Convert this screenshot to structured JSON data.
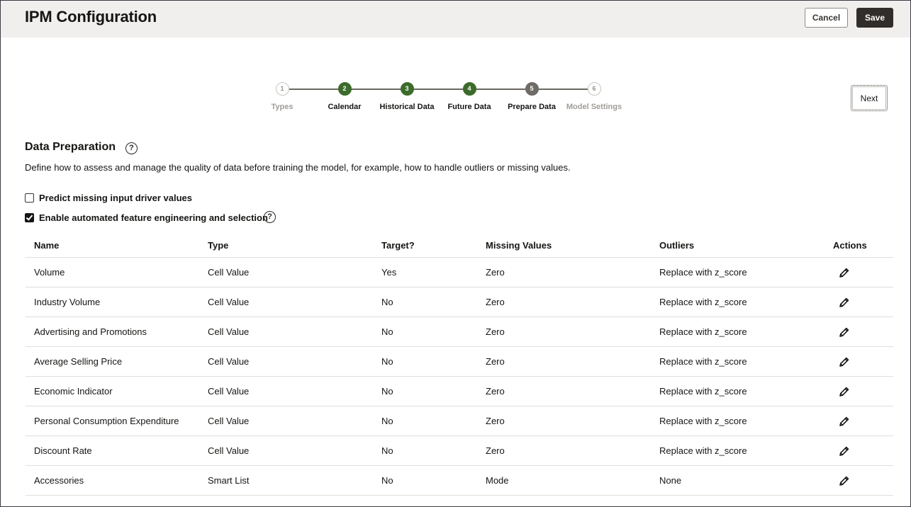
{
  "header": {
    "title": "IPM Configuration",
    "cancel_label": "Cancel",
    "save_label": "Save"
  },
  "stepper": {
    "steps": [
      {
        "number": "1",
        "label": "Types",
        "state": "future"
      },
      {
        "number": "2",
        "label": "Calendar",
        "state": "done"
      },
      {
        "number": "3",
        "label": "Historical Data",
        "state": "done"
      },
      {
        "number": "4",
        "label": "Future Data",
        "state": "done"
      },
      {
        "number": "5",
        "label": "Prepare Data",
        "state": "current"
      },
      {
        "number": "6",
        "label": "Model Settings",
        "state": "future"
      }
    ],
    "next_label": "Next"
  },
  "section": {
    "title": "Data Preparation",
    "help_icon": "?",
    "description": "Define how to assess and manage the quality of data before training the model, for example, how to handle outliers or missing values.",
    "options": [
      {
        "label": "Predict missing input driver values",
        "checked": false
      },
      {
        "label": "Enable automated feature engineering and selection",
        "checked": true
      }
    ]
  },
  "table": {
    "headers": {
      "name": "Name",
      "type": "Type",
      "target": "Target?",
      "missing": "Missing Values",
      "outliers": "Outliers",
      "actions": "Actions"
    },
    "rows": [
      {
        "name": "Volume",
        "type": "Cell Value",
        "target": "Yes",
        "missing": "Zero",
        "outliers": "Replace with z_score"
      },
      {
        "name": "Industry Volume",
        "type": "Cell Value",
        "target": "No",
        "missing": "Zero",
        "outliers": "Replace with z_score"
      },
      {
        "name": "Advertising and Promotions",
        "type": "Cell Value",
        "target": "No",
        "missing": "Zero",
        "outliers": "Replace with z_score"
      },
      {
        "name": "Average Selling Price",
        "type": "Cell Value",
        "target": "No",
        "missing": "Zero",
        "outliers": "Replace with z_score"
      },
      {
        "name": "Economic Indicator",
        "type": "Cell Value",
        "target": "No",
        "missing": "Zero",
        "outliers": "Replace with z_score"
      },
      {
        "name": "Personal Consumption Expenditure",
        "type": "Cell Value",
        "target": "No",
        "missing": "Zero",
        "outliers": "Replace with z_score"
      },
      {
        "name": "Discount Rate",
        "type": "Cell Value",
        "target": "No",
        "missing": "Zero",
        "outliers": "Replace with z_score"
      },
      {
        "name": "Accessories",
        "type": "Smart List",
        "target": "No",
        "missing": "Mode",
        "outliers": "None"
      }
    ],
    "action_icon": "pencil-icon"
  },
  "colors": {
    "step_done": "#3c6b2b",
    "step_current": "#6f6b66",
    "save_bg": "#312d2a",
    "header_bg": "#f1efed"
  }
}
